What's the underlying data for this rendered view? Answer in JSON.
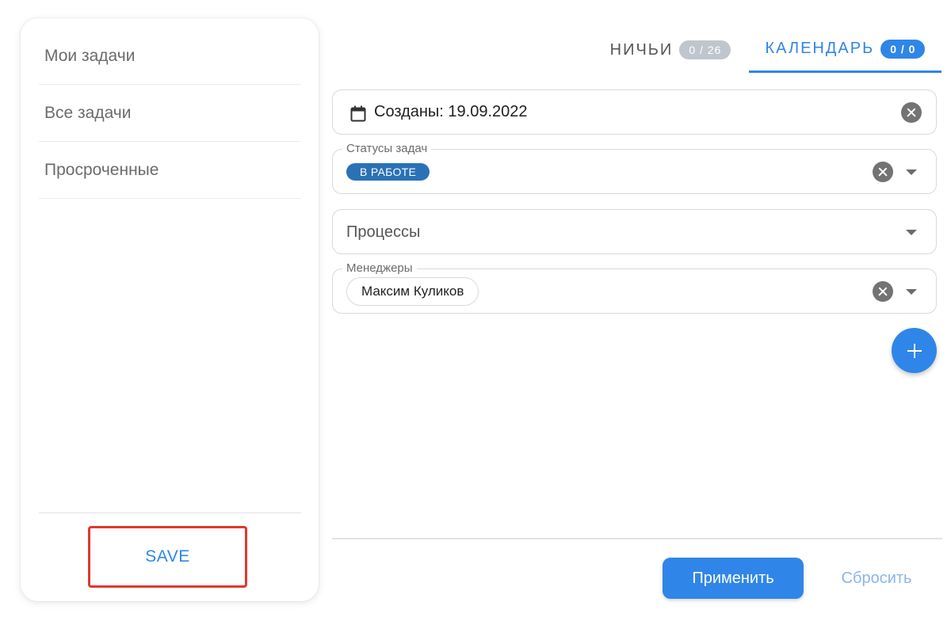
{
  "sidebar": {
    "items": [
      {
        "label": "Мои задачи"
      },
      {
        "label": "Все задачи"
      },
      {
        "label": "Просроченные"
      }
    ],
    "save_label": "SAVE"
  },
  "tabs": [
    {
      "label": "НИЧЬИ",
      "badge": "0 / 26",
      "active": false
    },
    {
      "label": "КАЛЕНДАРЬ",
      "badge": "0 / 0",
      "active": true
    }
  ],
  "filters": {
    "date": {
      "value": "Созданы: 19.09.2022",
      "icon": "calendar-icon"
    },
    "statuses": {
      "label": "Статусы задач",
      "chips": [
        "В РАБОТЕ"
      ]
    },
    "processes": {
      "placeholder": "Процессы"
    },
    "managers": {
      "label": "Менеджеры",
      "chips": [
        "Максим Куликов"
      ]
    }
  },
  "actions": {
    "add_icon": "plus-icon",
    "apply_label": "Применить",
    "reset_label": "Сбросить"
  },
  "colors": {
    "accent": "#2f86e8",
    "status_chip": "#2a72b5",
    "highlight": "#e0382e"
  }
}
